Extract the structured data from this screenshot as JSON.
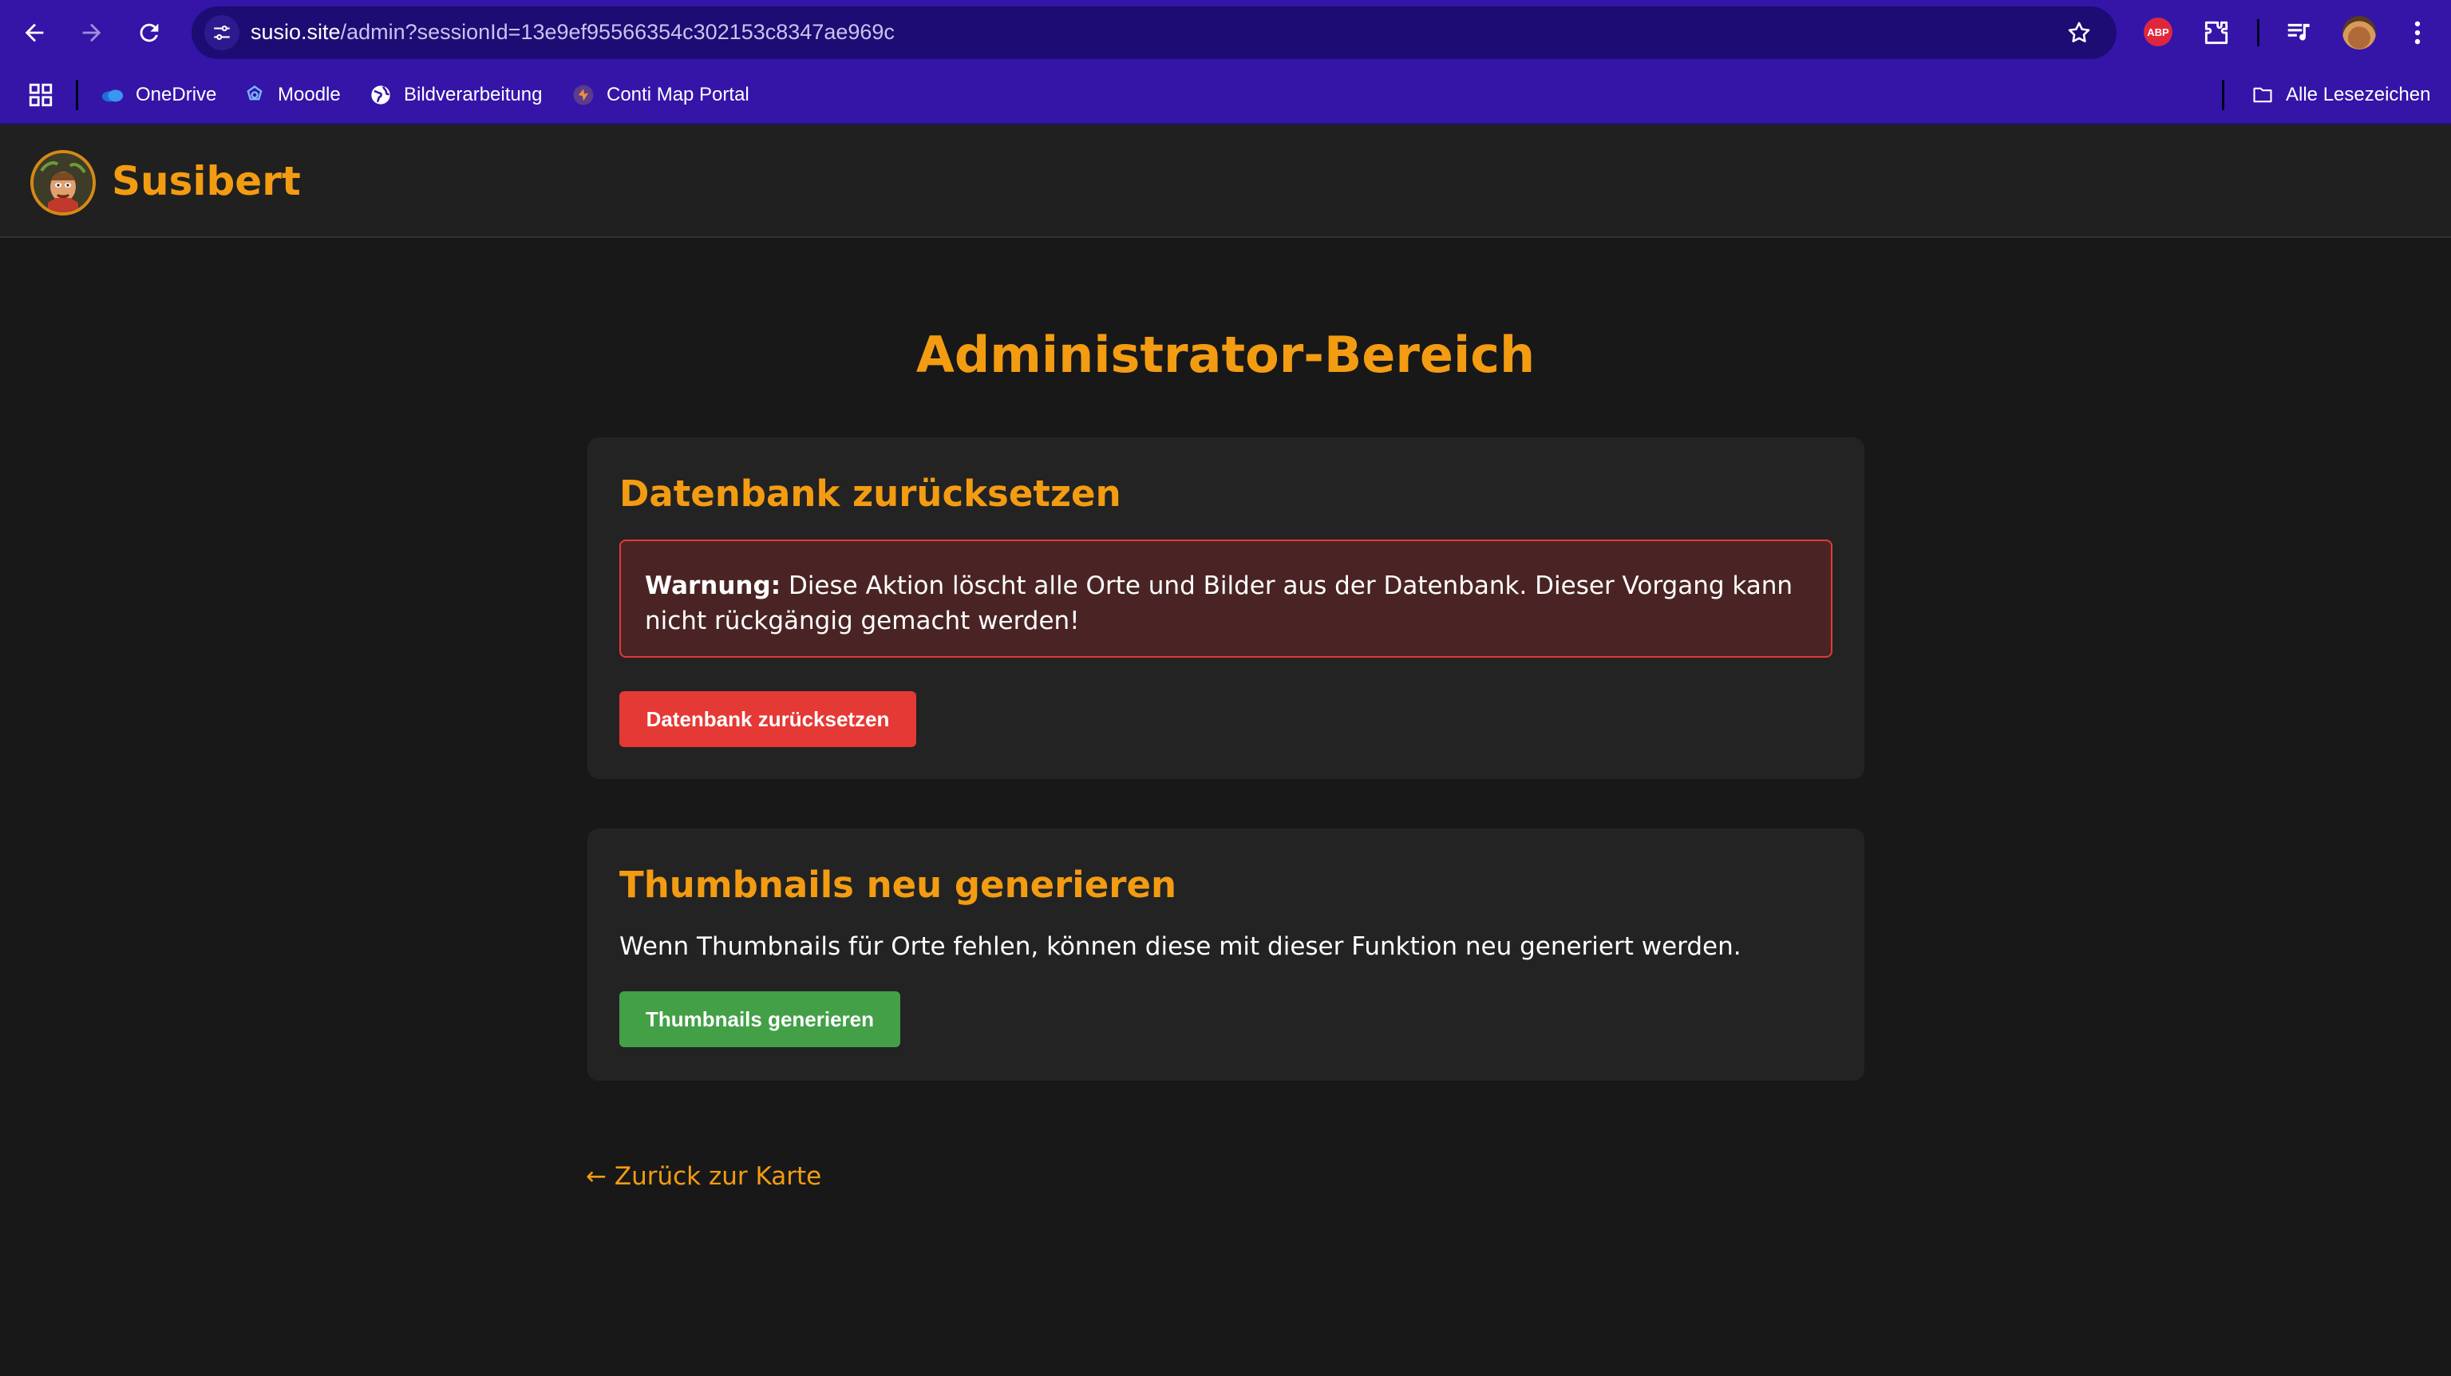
{
  "browser": {
    "url_host": "susio.site",
    "url_path": "/admin?sessionId=13e9ef95566354c302153c8347ae969c",
    "extension_abp_label": "ABP",
    "bookmarks": [
      {
        "label": "OneDrive",
        "icon": "onedrive-icon"
      },
      {
        "label": "Moodle",
        "icon": "moodle-icon"
      },
      {
        "label": "Bildverarbeitung",
        "icon": "globe-icon"
      },
      {
        "label": "Conti Map Portal",
        "icon": "conti-icon"
      }
    ],
    "all_bookmarks_label": "Alle Lesezeichen"
  },
  "header": {
    "brand": "Susibert"
  },
  "main": {
    "title": "Administrator-Bereich",
    "reset_card": {
      "heading": "Datenbank zurücksetzen",
      "warning_label": "Warnung:",
      "warning_text": " Diese Aktion löscht alle Orte und Bilder aus der Datenbank. Dieser Vorgang kann nicht rückgängig gemacht werden!",
      "button_label": "Datenbank zurücksetzen"
    },
    "thumb_card": {
      "heading": "Thumbnails neu generieren",
      "description": "Wenn Thumbnails für Orte fehlen, können diese mit dieser Funktion neu generiert werden.",
      "button_label": "Thumbnails generieren"
    },
    "back_link": "← Zurück zur Karte"
  },
  "colors": {
    "accent": "#f39c12",
    "danger": "#e53935",
    "success": "#43a047",
    "chrome": "#3415a8"
  }
}
